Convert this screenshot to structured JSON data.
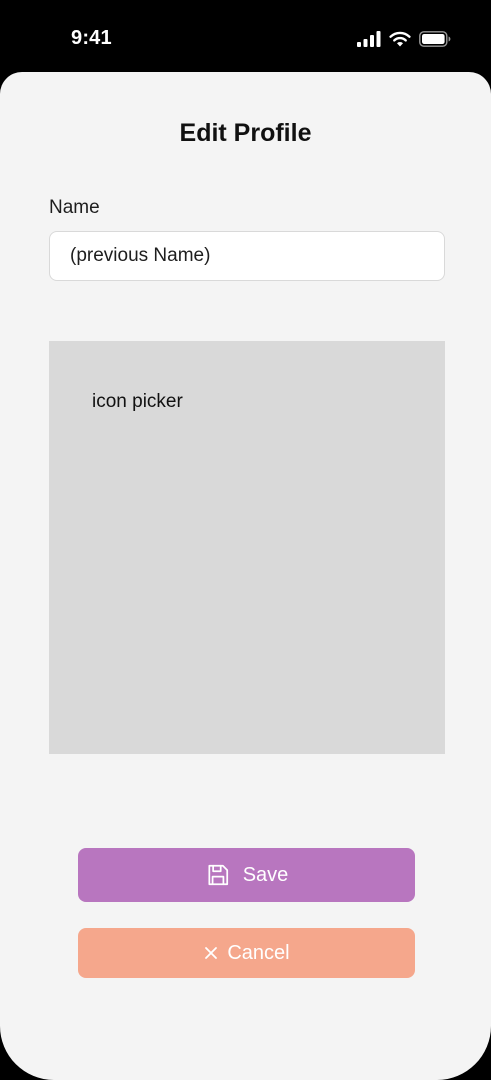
{
  "status_bar": {
    "time": "9:41",
    "icons": [
      "cellular-signal-icon",
      "wifi-icon",
      "battery-icon"
    ],
    "text_color": "#ffffff",
    "background": "#000000"
  },
  "page": {
    "title": "Edit Profile",
    "background": "#f4f4f4"
  },
  "form": {
    "name_label": "Name",
    "name_value": "(previous Name)"
  },
  "icon_picker": {
    "label": "icon picker",
    "background": "#d9d9d9"
  },
  "actions": {
    "save_label": "Save",
    "save_icon": "floppy-disk-icon",
    "save_color": "#b876bf",
    "cancel_label": "Cancel",
    "cancel_icon": "close-icon",
    "cancel_color": "#f5a78c"
  }
}
